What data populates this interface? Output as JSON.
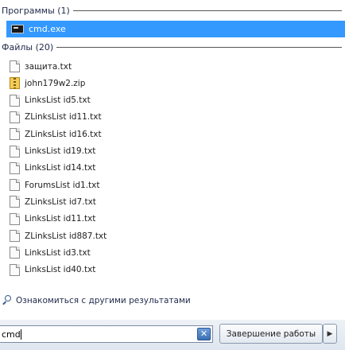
{
  "programs_header": "Программы (1)",
  "programs": [
    {
      "label": "cmd.exe",
      "icon": "cmd-icon",
      "selected": true
    }
  ],
  "files_header": "Файлы (20)",
  "files": [
    {
      "label": "защита.txt",
      "icon": "text-file-icon"
    },
    {
      "label": "john179w2.zip",
      "icon": "zip-file-icon"
    },
    {
      "label": "LinksList id5.txt",
      "icon": "text-file-icon"
    },
    {
      "label": "ZLinksList id11.txt",
      "icon": "text-file-icon"
    },
    {
      "label": "ZLinksList id16.txt",
      "icon": "text-file-icon"
    },
    {
      "label": "LinksList id19.txt",
      "icon": "text-file-icon"
    },
    {
      "label": "LinksList id14.txt",
      "icon": "text-file-icon"
    },
    {
      "label": "ForumsList id1.txt",
      "icon": "text-file-icon"
    },
    {
      "label": "ZLinksList id7.txt",
      "icon": "text-file-icon"
    },
    {
      "label": "LinksList id11.txt",
      "icon": "text-file-icon"
    },
    {
      "label": "ZLinksList id887.txt",
      "icon": "text-file-icon"
    },
    {
      "label": "LinksList id3.txt",
      "icon": "text-file-icon"
    },
    {
      "label": "LinksList id40.txt",
      "icon": "text-file-icon"
    }
  ],
  "see_more": "Ознакомиться с другими результатами",
  "search": {
    "value": "cmd",
    "clear_icon": "close-icon"
  },
  "shutdown_label": "Завершение работы",
  "arrow_glyph": "▶",
  "clear_glyph": "✕",
  "colors": {
    "selection": "#3399ff"
  }
}
